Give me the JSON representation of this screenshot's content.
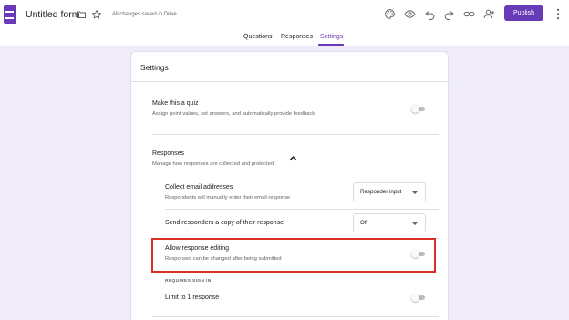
{
  "header": {
    "title": "Untitled form",
    "saved_status": "All changes saved in Drive",
    "publish_label": "Publish",
    "icons": [
      "forms-logo-icon",
      "folder-icon",
      "star-icon",
      "palette-icon",
      "preview-eye-icon",
      "undo-icon",
      "redo-icon",
      "link-icon",
      "add-collaborator-icon",
      "more-vert-icon"
    ]
  },
  "tabs": [
    {
      "label": "Questions",
      "active": false
    },
    {
      "label": "Responses",
      "active": false
    },
    {
      "label": "Settings",
      "active": true
    }
  ],
  "settings": {
    "title": "Settings",
    "quiz": {
      "label": "Make this a quiz",
      "description": "Assign point values, set answers, and automatically provide feedback",
      "enabled": false
    },
    "responses": {
      "label": "Responses",
      "description": "Manage how responses are collected and protected",
      "expanded": true,
      "collect_email": {
        "label": "Collect email addresses",
        "description": "Respondents will manually enter their email response",
        "selected": "Responder input"
      },
      "send_copy": {
        "label": "Send responders a copy of their response",
        "selected": "Off"
      },
      "allow_editing": {
        "label": "Allow response editing",
        "description": "Responses can be changed after being submitted",
        "enabled": false,
        "highlighted": true
      },
      "requires_sign_in_label": "REQUIRES SIGN IN",
      "limit_one": {
        "label": "Limit to 1 response",
        "enabled": false
      }
    }
  },
  "colors": {
    "brand": "#673ab7",
    "highlight": "#d93025",
    "background": "#f0ebf8"
  }
}
